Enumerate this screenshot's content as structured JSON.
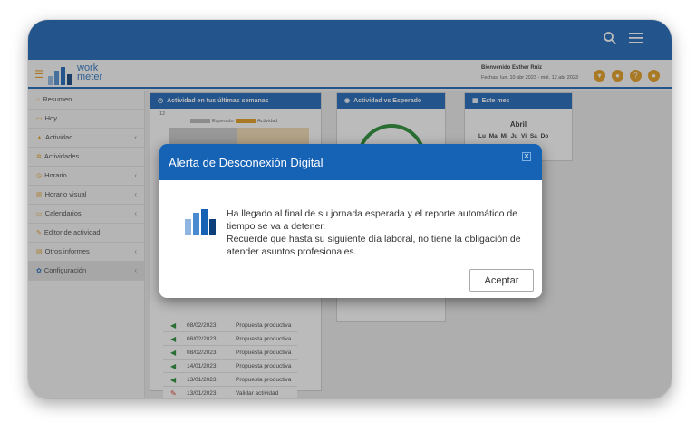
{
  "app": {
    "logo_text_top": "work",
    "logo_text_bottom": "meter",
    "welcome": "Bienvenido Esther Ruiz",
    "dates": "Fechas: lun. 10 abr 2023 - mié. 12 abr 2023"
  },
  "sidebar": {
    "items": [
      {
        "label": "Resumen",
        "icon": "home-icon"
      },
      {
        "label": "Hoy",
        "icon": "calendar-icon"
      },
      {
        "label": "Actividad",
        "icon": "chart-icon",
        "chevron": "‹"
      },
      {
        "label": "Actividades",
        "icon": "gears-icon"
      },
      {
        "label": "Horario",
        "icon": "clock-icon",
        "chevron": "‹"
      },
      {
        "label": "Horario visual",
        "icon": "bar-chart-icon",
        "chevron": "‹"
      },
      {
        "label": "Calendarios",
        "icon": "calendar-icon",
        "chevron": "‹"
      },
      {
        "label": "Editor de actividad",
        "icon": "edit-icon"
      },
      {
        "label": "Otros informes",
        "icon": "report-icon",
        "chevron": "‹"
      },
      {
        "label": "Configuración",
        "icon": "gear-icon",
        "chevron": "‹"
      }
    ]
  },
  "panels": {
    "activity": {
      "title": "Actividad en tus últimas semanas",
      "legend_expected": "Esperado",
      "legend_activity": "Actividad",
      "ytick": "12"
    },
    "vs": {
      "title": "Actividad vs Esperado"
    },
    "month": {
      "title": "Este mes",
      "month_name": "Abril",
      "days": "Lu Ma Mi Ju Vi Sa Do"
    }
  },
  "activity_rows": [
    {
      "date": "08/02/2023",
      "text": "Propuesta productiva",
      "icon": "megaphone-icon"
    },
    {
      "date": "08/02/2023",
      "text": "Propuesta productiva",
      "icon": "megaphone-icon"
    },
    {
      "date": "08/02/2023",
      "text": "Propuesta productiva",
      "icon": "megaphone-icon"
    },
    {
      "date": "14/01/2023",
      "text": "Propuesta productiva",
      "icon": "megaphone-icon"
    },
    {
      "date": "13/01/2023",
      "text": "Propuesta productiva",
      "icon": "megaphone-icon"
    },
    {
      "date": "13/01/2023",
      "text": "Validar actividad",
      "icon": "edit-icon"
    }
  ],
  "dialog": {
    "title": "Alerta de Desconexión Digital",
    "line1": "Ha llegado al final de su jornada esperada y el reporte automático de tiempo se va a detener.",
    "line2": "Recuerde que hasta su siguiente día laboral, no tiene la obligación de atender asuntos profesionales.",
    "button": "Aceptar",
    "close_glyph": "✕"
  },
  "colors": {
    "brand": "#1662b5",
    "accent": "#e59a16",
    "success": "#1f8a2e"
  }
}
